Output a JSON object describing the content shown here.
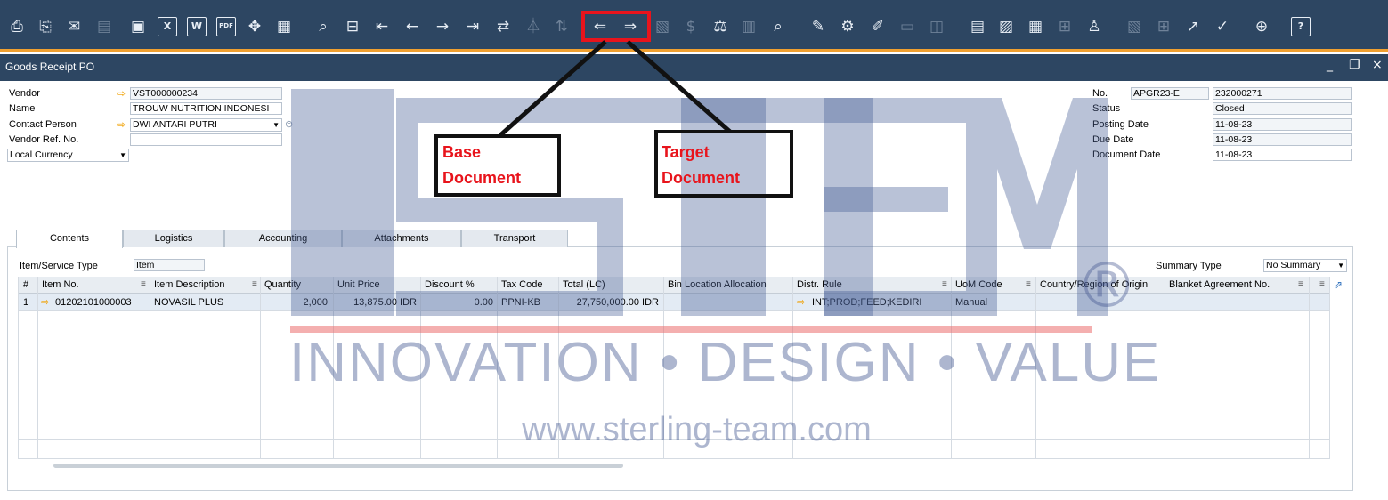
{
  "toolbar": {
    "icons": [
      "preview-icon",
      "print-icon",
      "email-icon",
      "sms-icon",
      "fax-icon",
      "excel-icon",
      "word-icon",
      "pdf-icon",
      "move-icon",
      "launch-app-icon",
      "find-icon",
      "add-icon",
      "first-record-icon",
      "previous-record-icon",
      "next-record-icon",
      "last-record-icon",
      "refresh-icon",
      "filter-icon",
      "sort-icon",
      "base-document-icon",
      "target-document-icon",
      "gross-profit-icon",
      "currency-icon",
      "balance-icon",
      "journal-icon",
      "query-icon",
      "edit-icon",
      "settings-icon",
      "form-settings-icon",
      "message-icon",
      "alert-icon",
      "draft-icon",
      "approval-icon",
      "calculator-icon",
      "structure-icon",
      "user-icon",
      "report-icon",
      "layout-icon",
      "excel-export-icon",
      "chart-icon",
      "web-icon",
      "help-icon"
    ],
    "word_icon": "W",
    "excel_icon": "X",
    "pdf_icon": "PDF",
    "help_icon": "?"
  },
  "window": {
    "title": "Goods Receipt PO",
    "minimize": "_",
    "restore": "❐",
    "close": "×"
  },
  "header_left": {
    "vendor_label": "Vendor",
    "vendor_value": "VST000000234",
    "name_label": "Name",
    "name_value": "TROUW NUTRITION INDONESI",
    "contact_label": "Contact Person",
    "contact_value": "DWI ANTARI PUTRI",
    "vendor_ref_label": "Vendor Ref. No.",
    "vendor_ref_value": "",
    "currency_value": "Local Currency"
  },
  "header_right": {
    "no_label": "No.",
    "series_value": "APGR23-E",
    "no_value": "232000271",
    "status_label": "Status",
    "status_value": "Closed",
    "posting_label": "Posting Date",
    "posting_value": "11-08-23",
    "due_label": "Due Date",
    "due_value": "11-08-23",
    "docdate_label": "Document Date",
    "docdate_value": "11-08-23"
  },
  "tabs": [
    "Contents",
    "Logistics",
    "Accounting",
    "Attachments",
    "Transport"
  ],
  "contents": {
    "item_type_label": "Item/Service Type",
    "item_type_value": "Item",
    "summary_label": "Summary Type",
    "summary_value": "No Summary"
  },
  "grid": {
    "columns": [
      "#",
      "Item No.",
      "Item Description",
      "Quantity",
      "Unit Price",
      "Discount %",
      "Tax Code",
      "Total (LC)",
      "Bin Location Allocation",
      "Distr. Rule",
      "UoM Code",
      "Country/Region of Origin",
      "Blanket Agreement No."
    ],
    "rows": [
      {
        "num": "1",
        "item_no": "01202101000003",
        "description": "NOVASIL PLUS",
        "quantity": "2,000",
        "unit_price": "13,875.00 IDR",
        "discount": "0.00",
        "tax_code": "PPNI-KB",
        "total": "27,750,000.00 IDR",
        "bin": "",
        "distr_rule": "INT;PROD;FEED;KEDIRI",
        "uom": "Manual",
        "country": "",
        "blanket": ""
      }
    ]
  },
  "annotations": {
    "base": "Base\nDocument",
    "base_line1": "Base",
    "base_line2": "Document",
    "target_line1": "Target",
    "target_line2": "Document"
  },
  "watermark": {
    "tagline": "INNOVATION • DESIGN • VALUE",
    "url": "www.sterling-team.com",
    "registered": "®"
  },
  "colors": {
    "toolbar_bg": "#2d4662",
    "accent_orange": "#f0a030",
    "annotation_red": "#e8141c"
  }
}
